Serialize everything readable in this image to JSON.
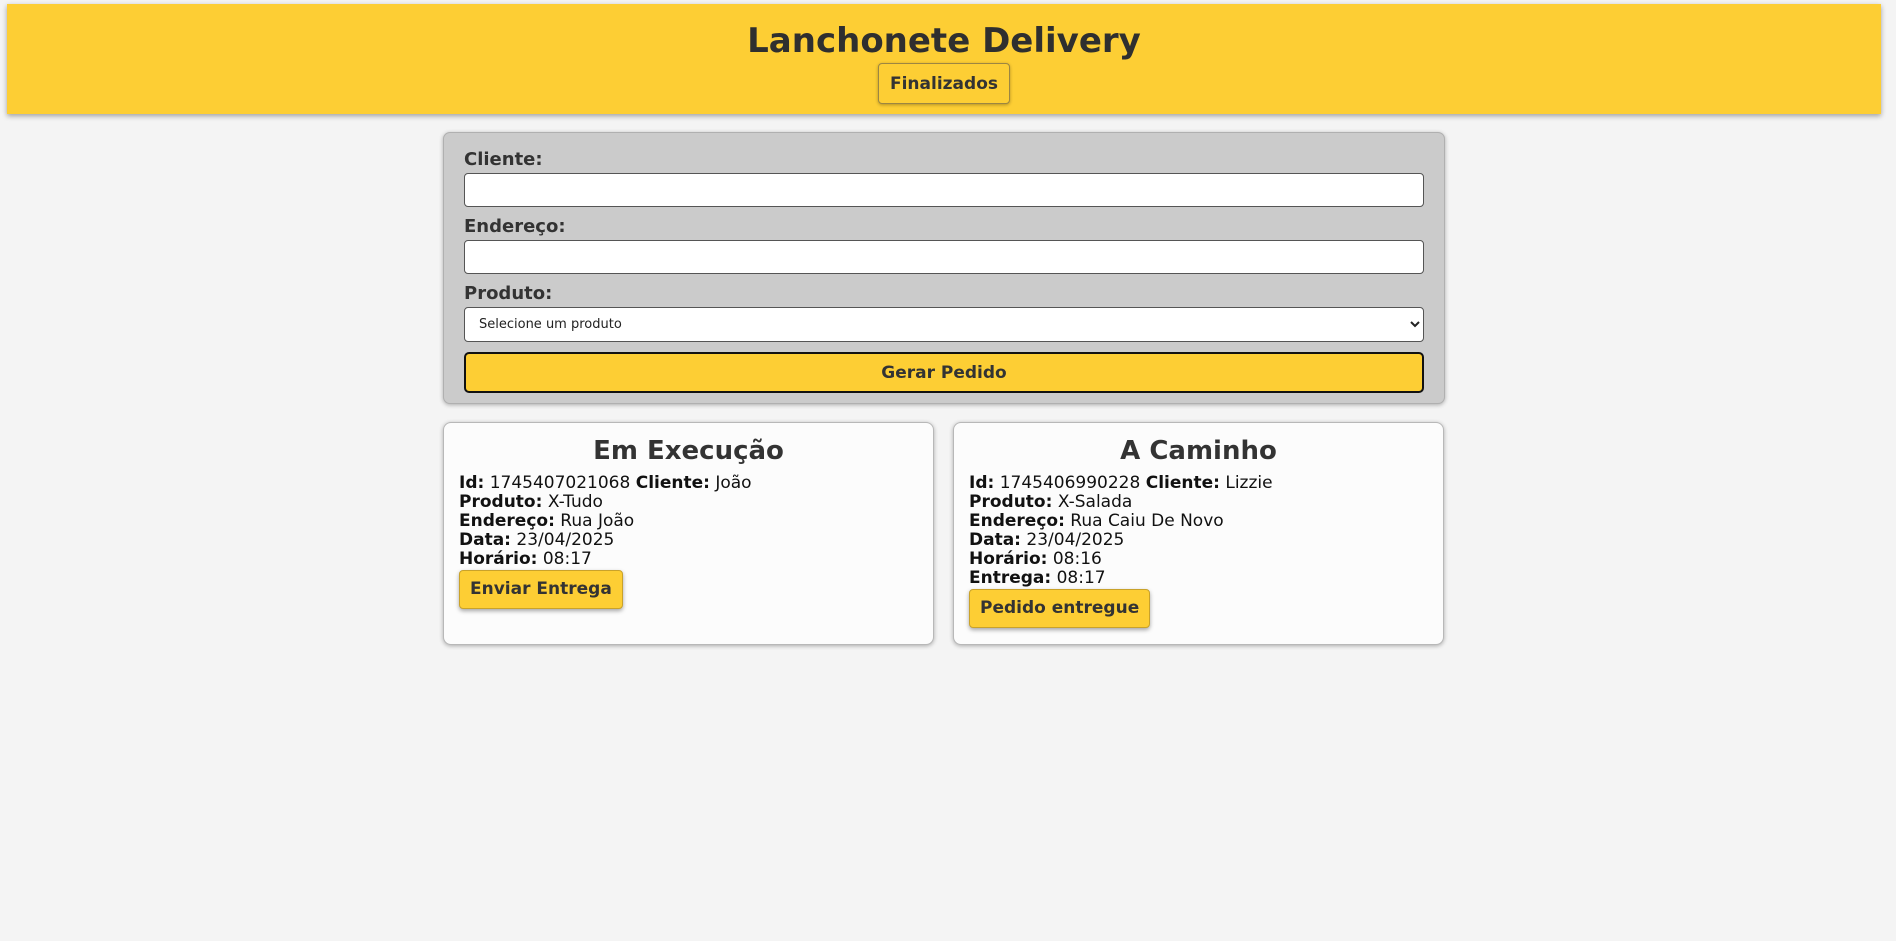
{
  "header": {
    "title": "Lanchonete Delivery",
    "finalizados_label": "Finalizados"
  },
  "form": {
    "cliente_label": "Cliente:",
    "cliente_value": "",
    "endereco_label": "Endereço:",
    "endereco_value": "",
    "produto_label": "Produto:",
    "produto_selected": "Selecione um produto",
    "submit_label": "Gerar Pedido"
  },
  "columns": {
    "em_execucao": {
      "title": "Em Execução",
      "order": {
        "id_label": "Id:",
        "id": "1745407021068",
        "cliente_label": "Cliente:",
        "cliente": "João",
        "produto_label": "Produto:",
        "produto": "X-Tudo",
        "endereco_label": "Endereço:",
        "endereco": "Rua João",
        "data_label": "Data:",
        "data": "23/04/2025",
        "horario_label": "Horário:",
        "horario": "08:17",
        "button_label": "Enviar Entrega"
      }
    },
    "a_caminho": {
      "title": "A Caminho",
      "order": {
        "id_label": "Id:",
        "id": "1745406990228",
        "cliente_label": "Cliente:",
        "cliente": "Lizzie",
        "produto_label": "Produto:",
        "produto": "X-Salada",
        "endereco_label": "Endereço:",
        "endereco": "Rua Caiu De Novo",
        "data_label": "Data:",
        "data": "23/04/2025",
        "horario_label": "Horário:",
        "horario": "08:16",
        "entrega_label": "Entrega:",
        "entrega": "08:17",
        "button_label": "Pedido entregue"
      }
    }
  },
  "colors": {
    "accent": "#fdce34",
    "page_background": "#f4f4f4",
    "form_background": "#cbcbcb",
    "card_background": "#fcfcfc"
  }
}
